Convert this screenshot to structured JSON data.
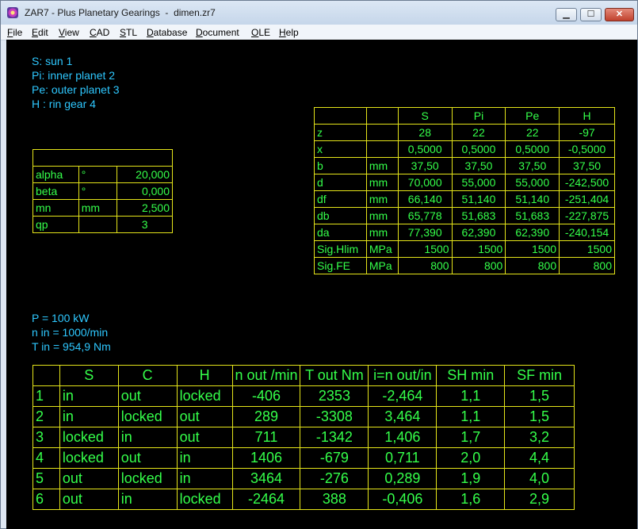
{
  "window": {
    "title": "ZAR7 - Plus Planetary Gearings  -  dimen.zr7"
  },
  "menu": [
    "File",
    "Edit",
    "View",
    "CAD",
    "STL",
    "Database",
    "Document",
    "OLE",
    "Help"
  ],
  "legend": [
    "S: sun 1",
    "Pi: inner planet 2",
    "Pe: outer planet 3",
    "H : rin gear 4"
  ],
  "params": {
    "header": "",
    "rows": [
      {
        "name": "alpha",
        "unit": "°",
        "value": "20,000"
      },
      {
        "name": "beta",
        "unit": "°",
        "value": "0,000"
      },
      {
        "name": "mn",
        "unit": "mm",
        "value": "2,500"
      },
      {
        "name": "qp",
        "unit": "",
        "value": "3"
      }
    ]
  },
  "gears": {
    "headers": [
      "",
      "",
      "S",
      "Pi",
      "Pe",
      "H"
    ],
    "rows": [
      [
        "z",
        "",
        "28",
        "22",
        "22",
        "-97"
      ],
      [
        "x",
        "",
        "0,5000",
        "0,5000",
        "0,5000",
        "-0,5000"
      ],
      [
        "b",
        "mm",
        "37,50",
        "37,50",
        "37,50",
        "37,50"
      ],
      [
        "d",
        "mm",
        "70,000",
        "55,000",
        "55,000",
        "-242,500"
      ],
      [
        "df",
        "mm",
        "66,140",
        "51,140",
        "51,140",
        "-251,404"
      ],
      [
        "db",
        "mm",
        "65,778",
        "51,683",
        "51,683",
        "-227,875"
      ],
      [
        "da",
        "mm",
        "77,390",
        "62,390",
        "62,390",
        "-240,154"
      ],
      [
        "Sig.Hlim",
        "MPa",
        "1500",
        "1500",
        "1500",
        "1500"
      ],
      [
        "Sig.FE",
        "MPa",
        "800",
        "800",
        "800",
        "800"
      ]
    ]
  },
  "power": [
    "P = 100 kW",
    "n in = 1000/min",
    "T in = 954,9 Nm"
  ],
  "modes": {
    "headers": [
      "",
      "S",
      "C",
      "H",
      "n out /min",
      "T out Nm",
      "i=n out/in",
      "SH min",
      "SF min"
    ],
    "rows": [
      [
        "1",
        "in",
        "out",
        "locked",
        "-406",
        "2353",
        "-2,464",
        "1,1",
        "1,5"
      ],
      [
        "2",
        "in",
        "locked",
        "out",
        "289",
        "-3308",
        "3,464",
        "1,1",
        "1,5"
      ],
      [
        "3",
        "locked",
        "in",
        "out",
        "711",
        "-1342",
        "1,406",
        "1,7",
        "3,2"
      ],
      [
        "4",
        "locked",
        "out",
        "in",
        "1406",
        "-679",
        "0,711",
        "2,0",
        "4,4"
      ],
      [
        "5",
        "out",
        "locked",
        "in",
        "3464",
        "-276",
        "0,289",
        "1,9",
        "4,0"
      ],
      [
        "6",
        "out",
        "in",
        "locked",
        "-2464",
        "388",
        "-0,406",
        "1,6",
        "2,9"
      ]
    ]
  }
}
